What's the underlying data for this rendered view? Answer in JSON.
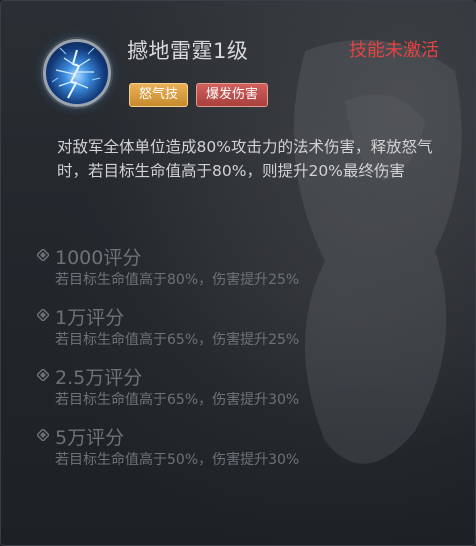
{
  "skill": {
    "title": "撼地雷霆1级",
    "status": "技能未激活",
    "icon": "lightning-skill-icon",
    "tags": [
      "怒气技",
      "爆发伤害"
    ],
    "description": "对敌军全体单位造成80%攻击力的法术伤害，释放怒气时，若目标生命值高于80%，则提升20%最终伤害"
  },
  "tiers": [
    {
      "title": "1000评分",
      "desc": "若目标生命值高于80%，伤害提升25%"
    },
    {
      "title": "1万评分",
      "desc": "若目标生命值高于65%，伤害提升25%"
    },
    {
      "title": "2.5万评分",
      "desc": "若目标生命值高于65%，伤害提升30%"
    },
    {
      "title": "5万评分",
      "desc": "若目标生命值高于50%，伤害提升30%"
    }
  ],
  "colors": {
    "status": "#e04444",
    "tag_rage": "#d89a3e",
    "tag_burst": "#b94c48",
    "locked_text": "#6e7277"
  }
}
